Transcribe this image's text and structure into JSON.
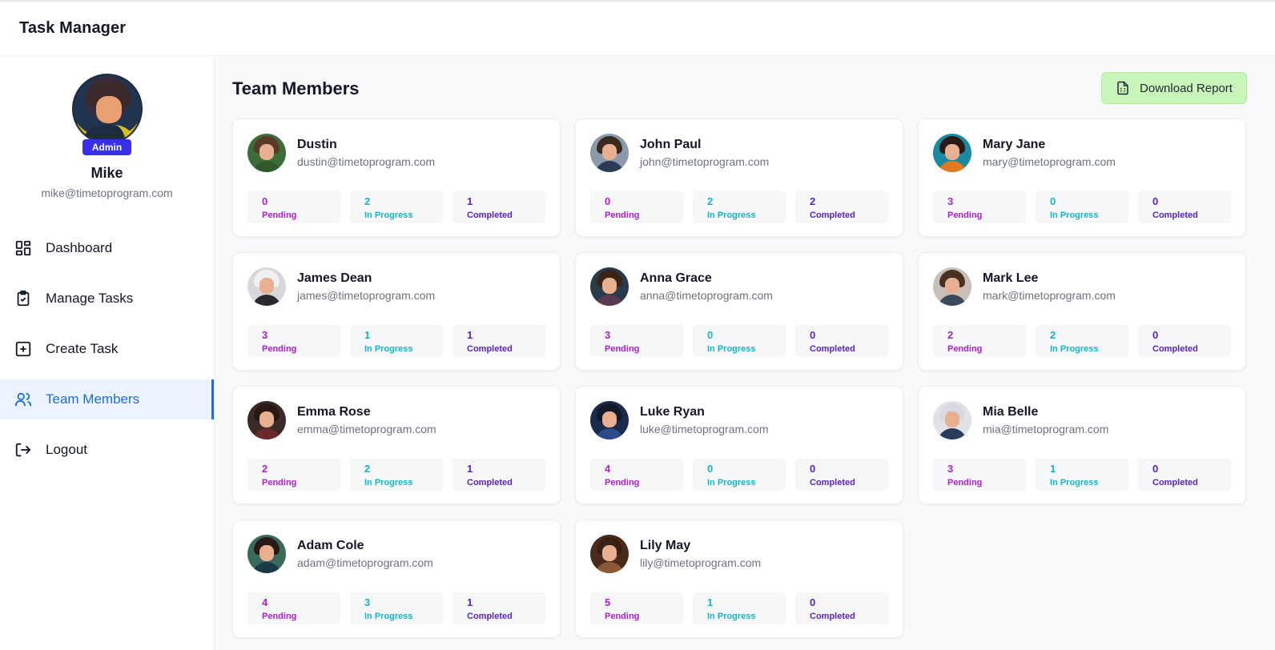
{
  "app": {
    "title": "Task Manager"
  },
  "user": {
    "name": "Mike",
    "email": "mike@timetoprogram.com",
    "role": "Admin"
  },
  "nav": [
    {
      "label": "Dashboard",
      "icon": "dashboard-icon"
    },
    {
      "label": "Manage Tasks",
      "icon": "clipboard-check-icon"
    },
    {
      "label": "Create Task",
      "icon": "plus-square-icon"
    },
    {
      "label": "Team Members",
      "icon": "users-icon",
      "active": true
    },
    {
      "label": "Logout",
      "icon": "logout-icon"
    }
  ],
  "page": {
    "title": "Team Members",
    "download_label": "Download Report"
  },
  "status_labels": {
    "pending": "Pending",
    "in_progress": "In Progress",
    "completed": "Completed"
  },
  "status_colors": {
    "pending": "#b01cd8",
    "in_progress": "#12b5cb",
    "completed": "#5a22c8"
  },
  "accent_colors": {
    "active_nav": "#1d6fe0",
    "role_badge": "#3730e8",
    "download_button": "#c9f5b8"
  },
  "members": [
    {
      "name": "Dustin",
      "email": "dustin@timetoprogram.com",
      "pending": "0",
      "in_progress": "2",
      "completed": "1"
    },
    {
      "name": "John Paul",
      "email": "john@timetoprogram.com",
      "pending": "0",
      "in_progress": "2",
      "completed": "2"
    },
    {
      "name": "Mary Jane",
      "email": "mary@timetoprogram.com",
      "pending": "3",
      "in_progress": "0",
      "completed": "0"
    },
    {
      "name": "James Dean",
      "email": "james@timetoprogram.com",
      "pending": "3",
      "in_progress": "1",
      "completed": "1"
    },
    {
      "name": "Anna Grace",
      "email": "anna@timetoprogram.com",
      "pending": "3",
      "in_progress": "0",
      "completed": "0"
    },
    {
      "name": "Mark Lee",
      "email": "mark@timetoprogram.com",
      "pending": "2",
      "in_progress": "2",
      "completed": "0"
    },
    {
      "name": "Emma Rose",
      "email": "emma@timetoprogram.com",
      "pending": "2",
      "in_progress": "2",
      "completed": "1"
    },
    {
      "name": "Luke Ryan",
      "email": "luke@timetoprogram.com",
      "pending": "4",
      "in_progress": "0",
      "completed": "0"
    },
    {
      "name": "Mia Belle",
      "email": "mia@timetoprogram.com",
      "pending": "3",
      "in_progress": "1",
      "completed": "0"
    },
    {
      "name": "Adam Cole",
      "email": "adam@timetoprogram.com",
      "pending": "4",
      "in_progress": "3",
      "completed": "1"
    },
    {
      "name": "Lily May",
      "email": "lily@timetoprogram.com",
      "pending": "5",
      "in_progress": "1",
      "completed": "0"
    }
  ]
}
